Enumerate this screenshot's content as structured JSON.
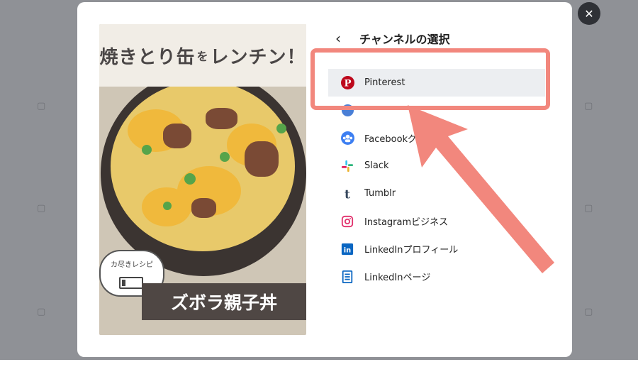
{
  "dialog": {
    "header": {
      "title": "チャンネルの選択",
      "back_icon": "chevron-left-icon"
    },
    "close_icon": "close-icon",
    "preview": {
      "title_main": "焼きとり缶",
      "title_small": "を",
      "title_rest": "レンチン！",
      "bubble_text": "カ尽きレシピ",
      "caption": "ズボラ親子丼"
    },
    "channels": [
      {
        "label": "Pinterest",
        "icon": "pinterest-icon",
        "color": "#bd081c",
        "selected": true
      },
      {
        "label": "",
        "icon": "hidden-channel-icon",
        "color": "#4a7fd6",
        "selected": false
      },
      {
        "label": "Facebookグ",
        "icon": "facebook-groups-icon",
        "color": "#3d7ff2",
        "selected": false
      },
      {
        "label": "Slack",
        "icon": "slack-icon",
        "color": "#36c5f0",
        "selected": false
      },
      {
        "label": "Tumblr",
        "icon": "tumblr-icon",
        "color": "#35465c",
        "selected": false
      },
      {
        "label": "Instagramビジネス",
        "icon": "instagram-icon",
        "color": "#e1306c",
        "selected": false
      },
      {
        "label": "LinkedInプロフィール",
        "icon": "linkedin-icon",
        "color": "#0a66c2",
        "selected": false
      },
      {
        "label": "LinkedInページ",
        "icon": "linkedin-page-icon",
        "color": "#0a66c2",
        "selected": false
      }
    ]
  },
  "annotation": {
    "color": "#f2877d"
  }
}
